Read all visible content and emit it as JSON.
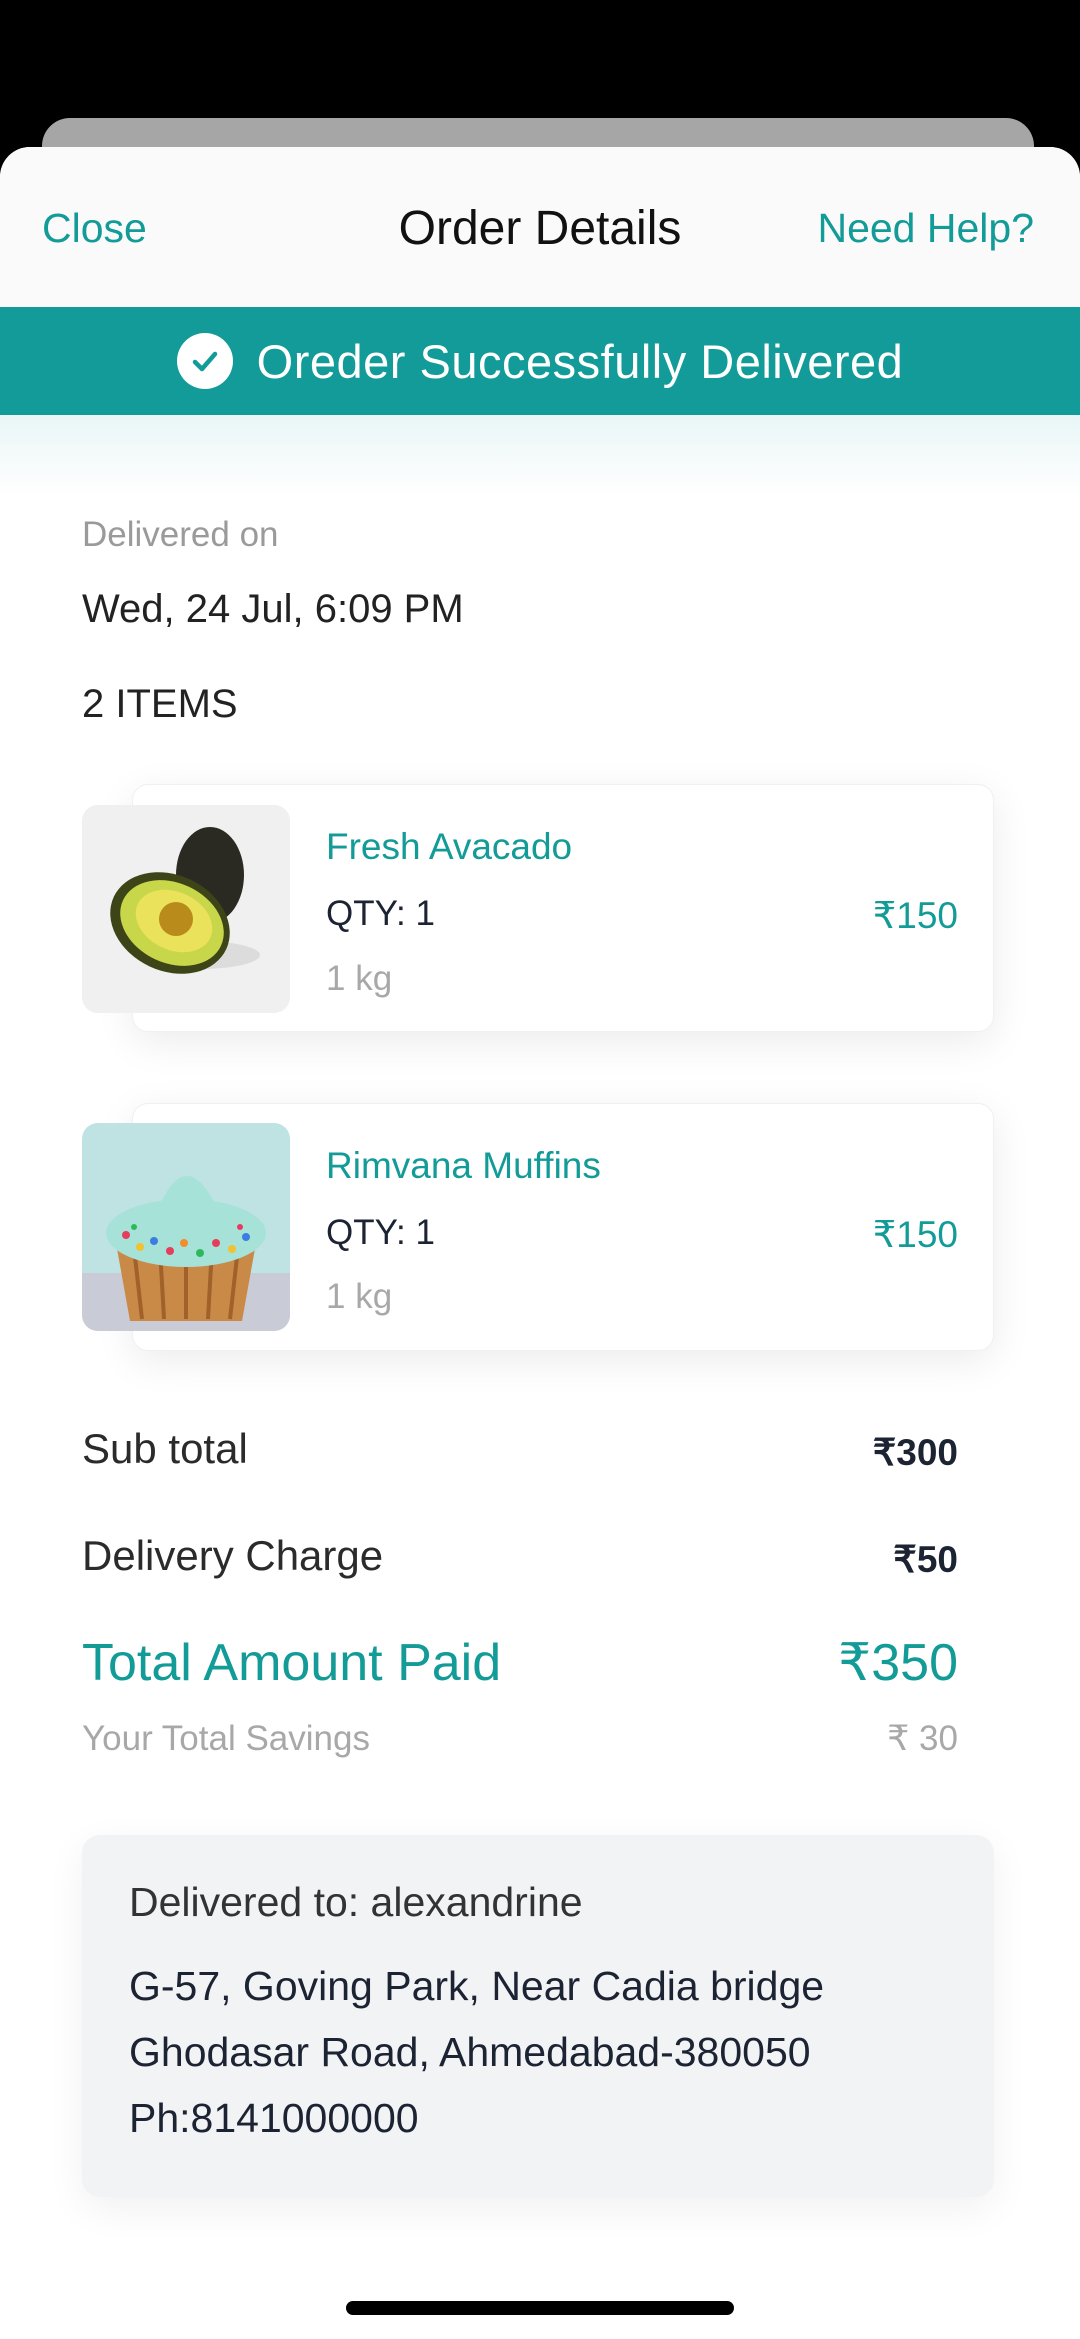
{
  "header": {
    "close_label": "Close",
    "title": "Order Details",
    "help_label": "Need Help?"
  },
  "banner": {
    "text": "Oreder Successfully Delivered",
    "icon": "check-circle-icon",
    "color": "#129b98"
  },
  "delivery": {
    "label": "Delivered on",
    "date": "Wed, 24 Jul, 6:09 PM"
  },
  "items_count": "2 ITEMS",
  "items": [
    {
      "name": "Fresh Avacado",
      "qty": "QTY: 1",
      "weight": "1 kg",
      "price": "₹150",
      "image": "avocado-image"
    },
    {
      "name": "Rimvana Muffins",
      "qty": "QTY: 1",
      "weight": "1 kg",
      "price": "₹150",
      "image": "muffin-image"
    }
  ],
  "summary": {
    "subtotal_label": "Sub total",
    "subtotal_value": "₹300",
    "delivery_label": "Delivery Charge",
    "delivery_value": "₹50",
    "total_label": "Total Amount Paid",
    "total_value": "₹350",
    "savings_label": "Your Total Savings",
    "savings_value": "₹ 30"
  },
  "address": {
    "title": "Delivered to: alexandrine",
    "line1": "G-57, Goving Park, Near Cadia bridge",
    "line2": "Ghodasar Road, Ahmedabad-380050",
    "phone": "Ph:8141000000"
  },
  "colors": {
    "accent": "#139b98",
    "text_dark": "#1c2333",
    "muted": "#a8a8a8"
  }
}
